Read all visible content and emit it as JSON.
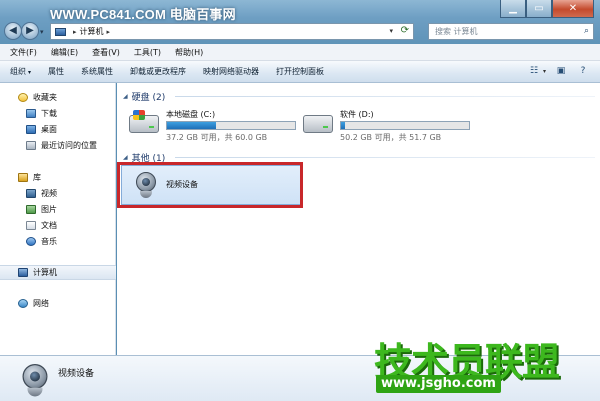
{
  "watermark_top": "WWW.PC841.COM 电脑百事网",
  "window": {
    "minimize": "▁",
    "maximize": "▭",
    "close": "✕"
  },
  "nav": {
    "back_icon": "◀",
    "forward_icon": "▶",
    "breadcrumb": "计算机",
    "breadcrumb_sep": "▸",
    "search_placeholder": "搜索 计算机"
  },
  "menu": [
    "文件(F)",
    "编辑(E)",
    "查看(V)",
    "工具(T)",
    "帮助(H)"
  ],
  "commands": {
    "organize": "组织",
    "properties": "属性",
    "system_properties": "系统属性",
    "uninstall": "卸载或更改程序",
    "map_drive": "映射网络驱动器",
    "control_panel": "打开控制面板"
  },
  "sidebar": {
    "favorites": "收藏夹",
    "downloads": "下载",
    "desktop": "桌面",
    "recent": "最近访问的位置",
    "libraries": "库",
    "videos": "视频",
    "pictures": "图片",
    "documents": "文档",
    "music": "音乐",
    "computer": "计算机",
    "network": "网络"
  },
  "content": {
    "hdd_group": "硬盘 (2)",
    "other_group": "其他 (1)",
    "drives": [
      {
        "name": "本地磁盘 (C:)",
        "space": "37.2 GB 可用，共 60.0 GB",
        "used_fraction": 0.38
      },
      {
        "name": "软件 (D:)",
        "space": "50.2 GB 可用，共 51.7 GB",
        "used_fraction": 0.03
      }
    ],
    "device": "视频设备"
  },
  "details": {
    "label": "视频设备"
  },
  "watermark_bottom": {
    "big": "技术员联盟",
    "url": "www.jsgho.com"
  },
  "colors": {
    "highlight_border": "#c8272a",
    "drive_fill": "#1e6fb8",
    "watermark_green": "#3db81e"
  }
}
